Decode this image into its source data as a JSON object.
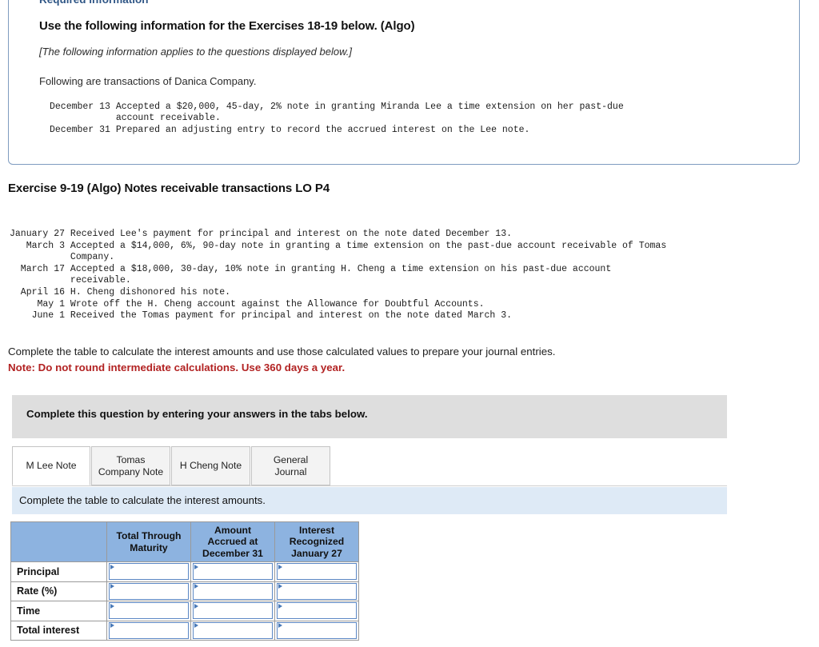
{
  "required_info_card": {
    "label": "Required information",
    "title": "Use the following information for the Exercises 18-19 below. (Algo)",
    "applies_note": "[The following information applies to the questions displayed below.]",
    "intro": "Following are transactions of Danica Company.",
    "transactions": "December 13 Accepted a $20,000, 45-day, 2% note in granting Miranda Lee a time extension on her past-due\n            account receivable.\nDecember 31 Prepared an adjusting entry to record the accrued interest on the Lee note."
  },
  "exercise": {
    "heading": "Exercise 9-19 (Algo) Notes receivable transactions LO P4",
    "transactions": "January 27 Received Lee's payment for principal and interest on the note dated December 13.\n   March 3 Accepted a $14,000, 6%, 90-day note in granting a time extension on the past-due account receivable of Tomas\n           Company.\n  March 17 Accepted a $18,000, 30-day, 10% note in granting H. Cheng a time extension on his past-due account\n           receivable.\n  April 16 H. Cheng dishonored his note.\n     May 1 Wrote off the H. Cheng account against the Allowance for Doubtful Accounts.\n    June 1 Received the Tomas payment for principal and interest on the note dated March 3.",
    "instruction": "Complete the table to calculate the interest amounts and use those calculated values to prepare your journal entries.",
    "note": "Note: Do not round intermediate calculations. Use 360 days a year."
  },
  "answer_area": {
    "banner": "Complete this question by entering your answers in the tabs below.",
    "tabs": [
      {
        "label_line1": "M Lee Note",
        "label_line2": "",
        "active": true
      },
      {
        "label_line1": "Tomas",
        "label_line2": "Company Note",
        "active": false
      },
      {
        "label_line1": "H Cheng Note",
        "label_line2": "",
        "active": false
      },
      {
        "label_line1": "General",
        "label_line2": "Journal",
        "active": false
      }
    ],
    "tab_instruction": "Complete the table to calculate the interest amounts.",
    "table": {
      "headers": [
        "",
        "Total Through\nMaturity",
        "Amount\nAccrued at\nDecember 31",
        "Interest\nRecognized\nJanuary 27"
      ],
      "rows": [
        {
          "label": "Principal",
          "values": [
            "",
            "",
            ""
          ]
        },
        {
          "label": "Rate (%)",
          "values": [
            "",
            "",
            ""
          ]
        },
        {
          "label": "Time",
          "values": [
            "",
            "",
            ""
          ]
        },
        {
          "label": "Total interest",
          "values": [
            "",
            "",
            ""
          ]
        }
      ]
    }
  },
  "colors": {
    "header_blue": "#8db3e0",
    "light_blue_bar": "#deeaf6",
    "gray_banner": "#dedede",
    "note_red": "#b22222",
    "label_blue": "#2e5585",
    "input_border_blue": "#5b87c4"
  }
}
